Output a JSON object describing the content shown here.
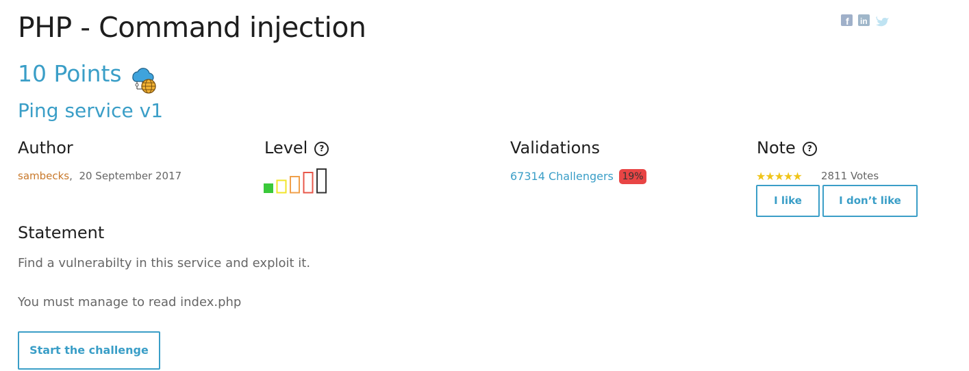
{
  "challenge": {
    "title": "PHP - Command injection",
    "points": "10 Points",
    "category_icon": "cloud-network-globe-icon",
    "subtitle": "Ping service v1"
  },
  "author": {
    "heading": "Author",
    "name": "sambecks",
    "separator": ",",
    "date": "20 September 2017"
  },
  "level": {
    "heading": "Level",
    "help_icon": "question-circle-icon",
    "current_level": 1,
    "max_level": 5,
    "colors": [
      "#3ac93a",
      "#f2e52a",
      "#f0a04b",
      "#e8574a",
      "#333333"
    ]
  },
  "validations": {
    "heading": "Validations",
    "challengers": "67314 Challengers",
    "percent": "19%",
    "percent_color": "#e84545"
  },
  "note": {
    "heading": "Note",
    "help_icon": "question-circle-icon",
    "stars": "★★★★★",
    "rating": 5,
    "votes": "2811 Votes",
    "like_label": "I like",
    "dislike_label": "I don’t like"
  },
  "statement": {
    "heading": "Statement",
    "line1": "Find a vulnerabilty in this service and exploit it.",
    "line2": "You must manage to read index.php",
    "start_label": "Start the challenge"
  },
  "social": {
    "icons": [
      "facebook-icon",
      "linkedin-icon",
      "twitter-icon"
    ]
  },
  "colors": {
    "accent": "#3a9ec7",
    "author_link": "#c8782a",
    "star": "#f0c419"
  }
}
